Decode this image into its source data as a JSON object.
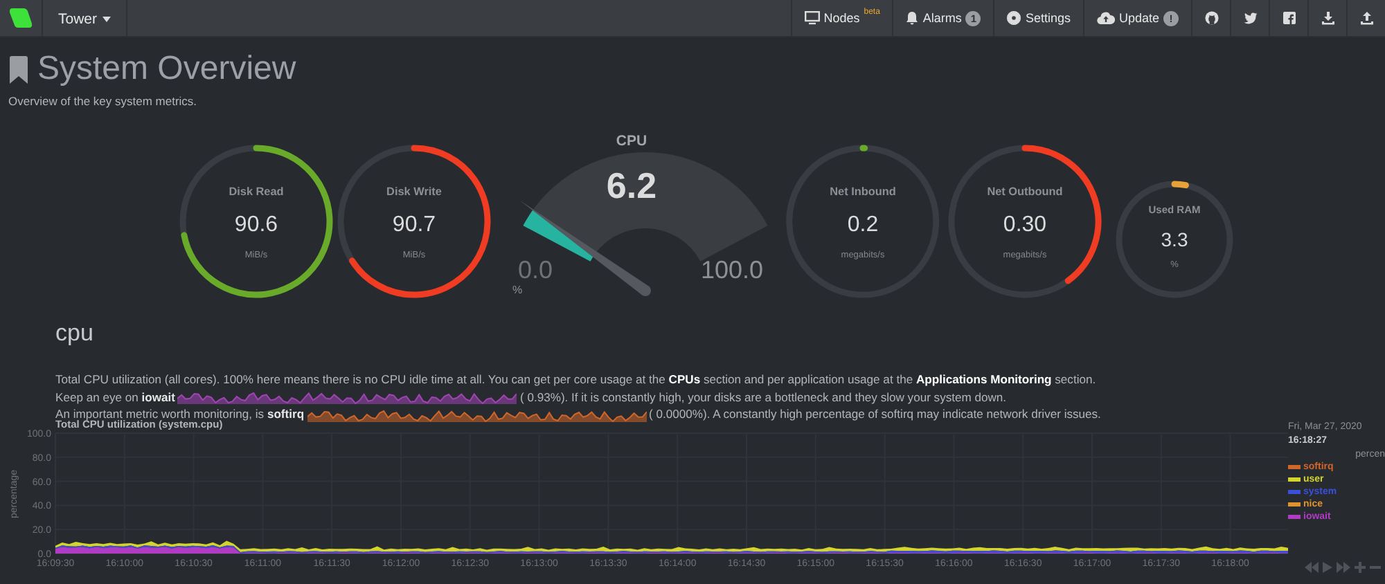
{
  "navbar": {
    "brand": "Tower",
    "items": [
      {
        "kind": "nodes",
        "label": "Nodes",
        "badge": {
          "kind": "superscript",
          "text": "beta"
        }
      },
      {
        "kind": "alarms",
        "label": "Alarms",
        "badge": {
          "kind": "count",
          "text": "1"
        }
      },
      {
        "kind": "settings",
        "label": "Settings"
      },
      {
        "kind": "update",
        "label": "Update",
        "badge": {
          "kind": "count",
          "text": "!"
        }
      }
    ]
  },
  "header": {
    "title": "System Overview",
    "subtitle": "Overview of the key system metrics."
  },
  "gauges": [
    {
      "kind": "ring",
      "title": "Disk Read",
      "value": "90.6",
      "unit": "MiB/s",
      "color": "#6aaa2a"
    },
    {
      "kind": "ring",
      "title": "Disk Write",
      "value": "90.7",
      "unit": "MiB/s",
      "color": "#f03c23"
    },
    {
      "kind": "dial",
      "title": "CPU",
      "value": "6.2",
      "min": "0.0",
      "max": "100.0",
      "unit": "%",
      "color": "#26b3a0"
    },
    {
      "kind": "ring",
      "title": "Net Inbound",
      "value": "0.2",
      "unit": "megabits/s",
      "color": "#6aaa2a"
    },
    {
      "kind": "ring",
      "title": "Net Outbound",
      "value": "0.30",
      "unit": "megabits/s",
      "color": "#f03c23"
    },
    {
      "kind": "small-ring",
      "title": "Used RAM",
      "value": "3.3",
      "unit": "%",
      "color": "#e8a23a"
    }
  ],
  "section": {
    "heading": "cpu",
    "lines": [
      {
        "segments": [
          {
            "kind": "text",
            "text": "Total CPU utilization (all cores). 100% here means there is no CPU idle time at all. You can get per core usage at the "
          },
          {
            "kind": "link",
            "text": "CPUs"
          },
          {
            "kind": "text",
            "text": " section and per application usage at the "
          },
          {
            "kind": "link",
            "text": "Applications Monitoring"
          },
          {
            "kind": "text",
            "text": " section."
          }
        ]
      },
      {
        "segments": [
          {
            "kind": "text",
            "text": "Keep an eye on **iowait**"
          },
          {
            "kind": "sparkline",
            "color": "#a044b4"
          },
          {
            "kind": "text",
            "text": "( 0.93%). If it is constantly high, your disks are a bottleneck and they slow your system down."
          }
        ]
      },
      {
        "segments": [
          {
            "kind": "text",
            "text": "An important metric worth monitoring, is **softirq**"
          },
          {
            "kind": "sparkline",
            "color": "#d0662a"
          },
          {
            "kind": "text",
            "text": "( 0.0000%). A constantly high percentage of softirq may indicate network driver issues."
          }
        ]
      }
    ]
  },
  "chart": {
    "legend_header": {
      "date": "Fri, Mar 27, 2020",
      "time": "16:18:27",
      "units": "percen"
    },
    "title": "Total CPU utilization (system.cpu)",
    "y_axis_label": "percentage",
    "y_ticks": [
      "100.0",
      "80.0",
      "60.0",
      "40.0",
      "20.0",
      "0.0"
    ],
    "x_ticks": [
      "16:09:30",
      "16:10:00",
      "16:10:30",
      "16:11:00",
      "16:11:30",
      "16:12:00",
      "16:12:30",
      "16:13:00",
      "16:13:30",
      "16:14:00",
      "16:14:30",
      "16:15:00",
      "16:15:30",
      "16:16:00",
      "16:16:30",
      "16:17:00",
      "16:17:30",
      "16:18:00"
    ],
    "legend": [
      {
        "name": "softirq",
        "color": "#d0662a"
      },
      {
        "name": "user",
        "color": "#d4d42c"
      },
      {
        "name": "system",
        "color": "#3b50d8"
      },
      {
        "name": "nice",
        "color": "#e0922e"
      },
      {
        "name": "iowait",
        "color": "#b03cc4"
      }
    ]
  }
}
